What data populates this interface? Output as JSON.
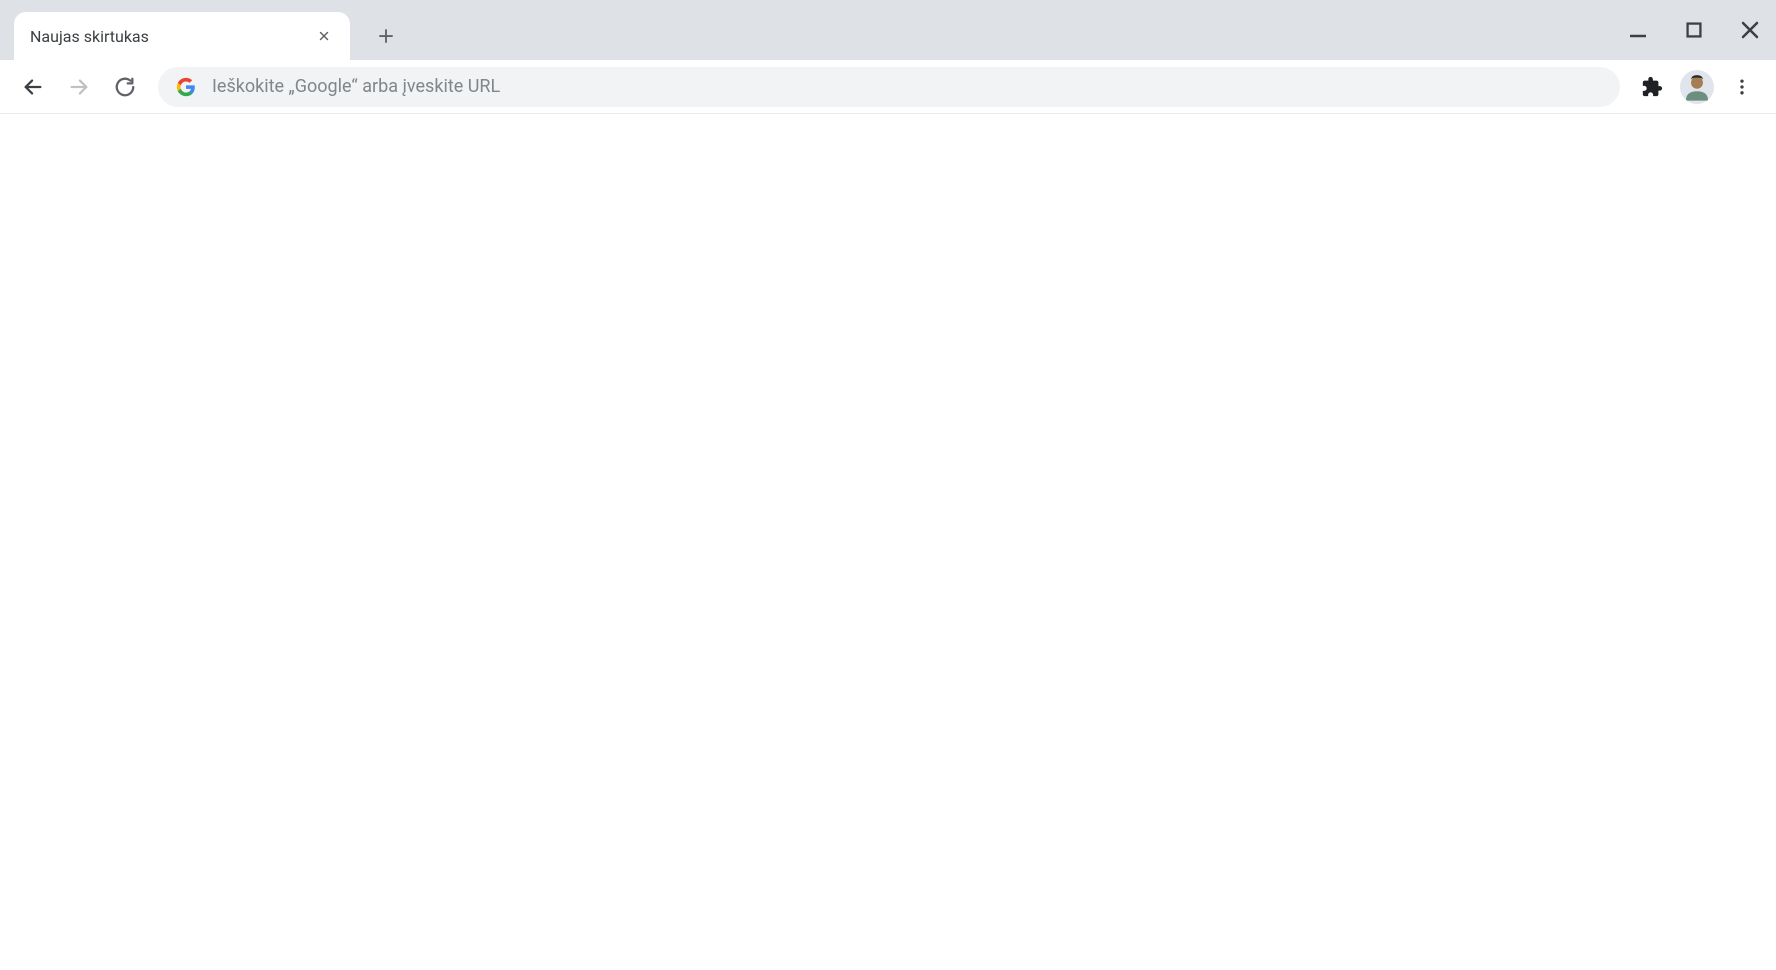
{
  "tab": {
    "title": "Naujas skirtukas"
  },
  "omnibox": {
    "placeholder": "Ieškokite „Google“ arba įveskite URL"
  }
}
